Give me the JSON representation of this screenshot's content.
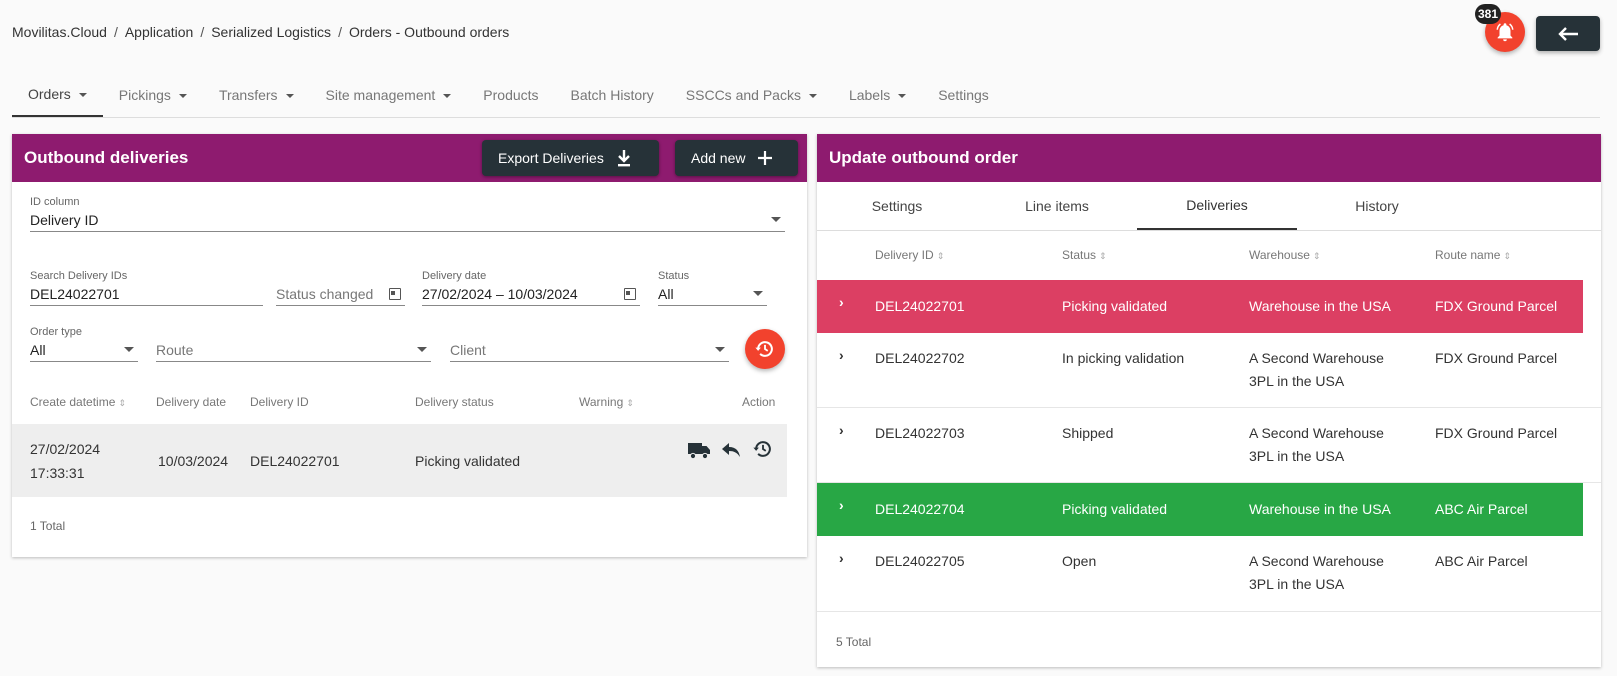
{
  "breadcrumb": [
    "Movilitas.Cloud",
    "Application",
    "Serialized Logistics",
    "Orders - Outbound orders"
  ],
  "notifications": {
    "count": "381",
    "icon": "bell-icon"
  },
  "nav": [
    {
      "label": "Orders",
      "dropdown": true,
      "active": true
    },
    {
      "label": "Pickings",
      "dropdown": true
    },
    {
      "label": "Transfers",
      "dropdown": true
    },
    {
      "label": "Site management",
      "dropdown": true
    },
    {
      "label": "Products",
      "dropdown": false
    },
    {
      "label": "Batch History",
      "dropdown": false
    },
    {
      "label": "SSCCs and Packs",
      "dropdown": true
    },
    {
      "label": "Labels",
      "dropdown": true
    },
    {
      "label": "Settings",
      "dropdown": false
    }
  ],
  "left": {
    "title": "Outbound deliveries",
    "export_label": "Export Deliveries",
    "add_label": "Add new",
    "id_column": {
      "label": "ID column",
      "value": "Delivery ID"
    },
    "search": {
      "label": "Search Delivery IDs",
      "value": "DEL24022701"
    },
    "status_changed": {
      "placeholder": "Status changed"
    },
    "delivery_date": {
      "label": "Delivery date",
      "value": "27/02/2024 – 10/03/2024"
    },
    "status": {
      "label": "Status",
      "value": "All"
    },
    "order_type": {
      "label": "Order type",
      "value": "All"
    },
    "route": {
      "placeholder": "Route"
    },
    "client": {
      "placeholder": "Client"
    },
    "columns": {
      "create": "Create datetime",
      "delivery_date": "Delivery date",
      "delivery_id": "Delivery ID",
      "delivery_status": "Delivery status",
      "warning": "Warning",
      "action": "Action"
    },
    "row": {
      "create_date": "27/02/2024",
      "create_time": "17:33:31",
      "delivery_date": "10/03/2024",
      "delivery_id": "DEL24022701",
      "status": "Picking validated"
    },
    "total": "1 Total"
  },
  "right": {
    "title": "Update outbound order",
    "tabs": [
      "Settings",
      "Line items",
      "Deliveries",
      "History"
    ],
    "active_tab": "Deliveries",
    "columns": {
      "delivery_id": "Delivery ID",
      "status": "Status",
      "warehouse": "Warehouse",
      "route": "Route name"
    },
    "rows": [
      {
        "id": "DEL24022701",
        "status": "Picking validated",
        "warehouse_l1": "Warehouse in the USA",
        "warehouse_l2": "",
        "route": "FDX Ground Parcel",
        "highlight": "#dc3f63"
      },
      {
        "id": "DEL24022702",
        "status": "In picking validation",
        "warehouse_l1": "A Second Warehouse",
        "warehouse_l2": "3PL in the USA",
        "route": "FDX Ground Parcel",
        "highlight": ""
      },
      {
        "id": "DEL24022703",
        "status": "Shipped",
        "warehouse_l1": "A Second Warehouse",
        "warehouse_l2": "3PL in the USA",
        "route": "FDX Ground Parcel",
        "highlight": ""
      },
      {
        "id": "DEL24022704",
        "status": "Picking validated",
        "warehouse_l1": "Warehouse in the USA",
        "warehouse_l2": "",
        "route": "ABC Air Parcel",
        "highlight": "#28a745"
      },
      {
        "id": "DEL24022705",
        "status": "Open",
        "warehouse_l1": "A Second Warehouse",
        "warehouse_l2": "3PL in the USA",
        "route": "ABC Air Parcel",
        "highlight": ""
      }
    ],
    "total": "5 Total"
  },
  "colors": {
    "header": "#8e1b6f",
    "dark_button": "#263238",
    "accent_red": "#f2422d",
    "row_red": "#dc3f63",
    "row_green": "#28a745"
  }
}
